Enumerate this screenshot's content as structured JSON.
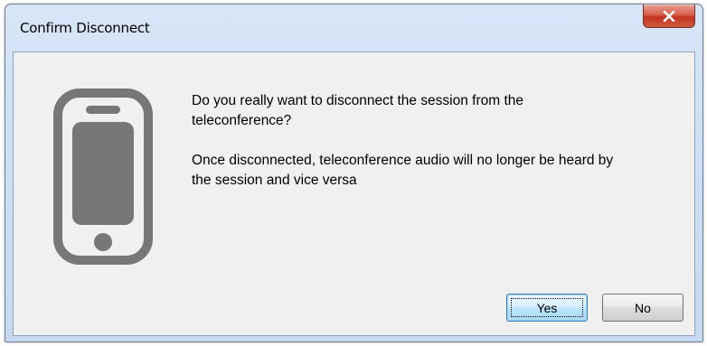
{
  "window": {
    "title": "Confirm Disconnect"
  },
  "icons": {
    "close": "close-icon",
    "dialog": "mobile-phone-icon"
  },
  "message": {
    "question": "Do you really want to disconnect the session from the teleconference?",
    "detail": "Once disconnected, teleconference audio will no longer be heard by the session and vice versa"
  },
  "buttons": {
    "yes_label": "Yes",
    "no_label": "No"
  },
  "colors": {
    "close_button": "#c7432d",
    "phone_icon": "#777777",
    "dialog_background": "#f0f0f0",
    "title_bar": "#cfe0f4"
  }
}
